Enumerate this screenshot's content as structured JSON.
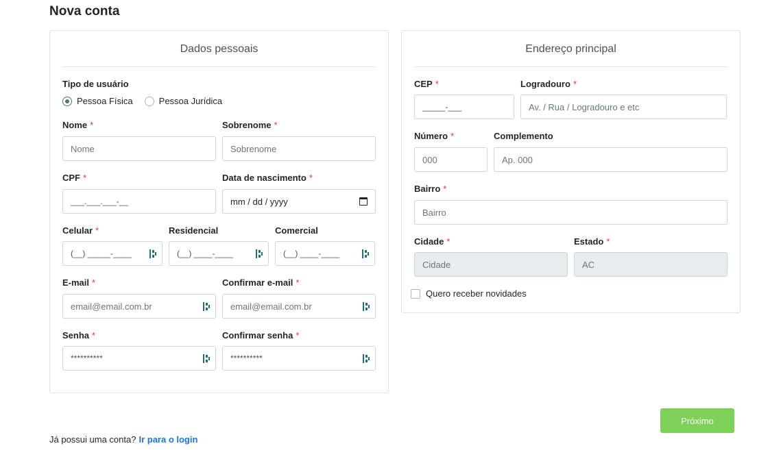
{
  "page": {
    "title": "Nova conta"
  },
  "personal": {
    "section_title": "Dados pessoais",
    "user_type": {
      "label": "Tipo de usuário",
      "options": [
        {
          "label": "Pessoa Física",
          "checked": true
        },
        {
          "label": "Pessoa Jurídica",
          "checked": false
        }
      ]
    },
    "nome": {
      "label": "Nome",
      "required": "*",
      "placeholder": "Nome"
    },
    "sobrenome": {
      "label": "Sobrenome",
      "required": "*",
      "placeholder": "Sobrenome"
    },
    "cpf": {
      "label": "CPF",
      "required": "*",
      "mask": "___.___.___-__"
    },
    "nascimento": {
      "label": "Data de nascimento",
      "required": "*",
      "placeholder": "mm / dd / yyyy"
    },
    "celular": {
      "label": "Celular",
      "required": "*",
      "mask": "(__) _____-____"
    },
    "residencial": {
      "label": "Residencial",
      "mask": "(__) ____-____"
    },
    "comercial": {
      "label": "Comercial",
      "mask": "(__) ____-____"
    },
    "email": {
      "label": "E-mail",
      "required": "*",
      "placeholder": "email@email.com.br"
    },
    "confirm_email": {
      "label": "Confirmar e-mail",
      "required": "*",
      "placeholder": "email@email.com.br"
    },
    "senha": {
      "label": "Senha",
      "required": "*",
      "placeholder": "**********"
    },
    "confirm_senha": {
      "label": "Confirmar senha",
      "required": "*",
      "placeholder": "**********"
    }
  },
  "address": {
    "section_title": "Endereço principal",
    "cep": {
      "label": "CEP",
      "required": "*",
      "mask": "_____-___"
    },
    "logradouro": {
      "label": "Logradouro",
      "required": "*",
      "placeholder": "Av. / Rua / Logradouro e etc"
    },
    "numero": {
      "label": "Número",
      "required": "*",
      "placeholder": "000"
    },
    "complemento": {
      "label": "Complemento",
      "placeholder": "Ap. 000"
    },
    "bairro": {
      "label": "Bairro",
      "required": "*",
      "placeholder": "Bairro"
    },
    "cidade": {
      "label": "Cidade",
      "required": "*",
      "placeholder": "Cidade"
    },
    "estado": {
      "label": "Estado",
      "required": "*",
      "placeholder": "AC"
    },
    "newsletter": {
      "label": "Quero receber novidades",
      "checked": false
    }
  },
  "actions": {
    "next_label": "Próximo"
  },
  "footer": {
    "question": "Já possui uma conta?",
    "login_link": "Ir para o login"
  },
  "colors": {
    "accent_green": "#7dd058",
    "radio_green": "#4a7c59",
    "required_red": "#dc3545",
    "link_blue": "#1a73e8",
    "icon_teal": "#1f6f78"
  },
  "icons": {
    "password_manager": "password-manager-icon",
    "calendar": "calendar-icon"
  }
}
